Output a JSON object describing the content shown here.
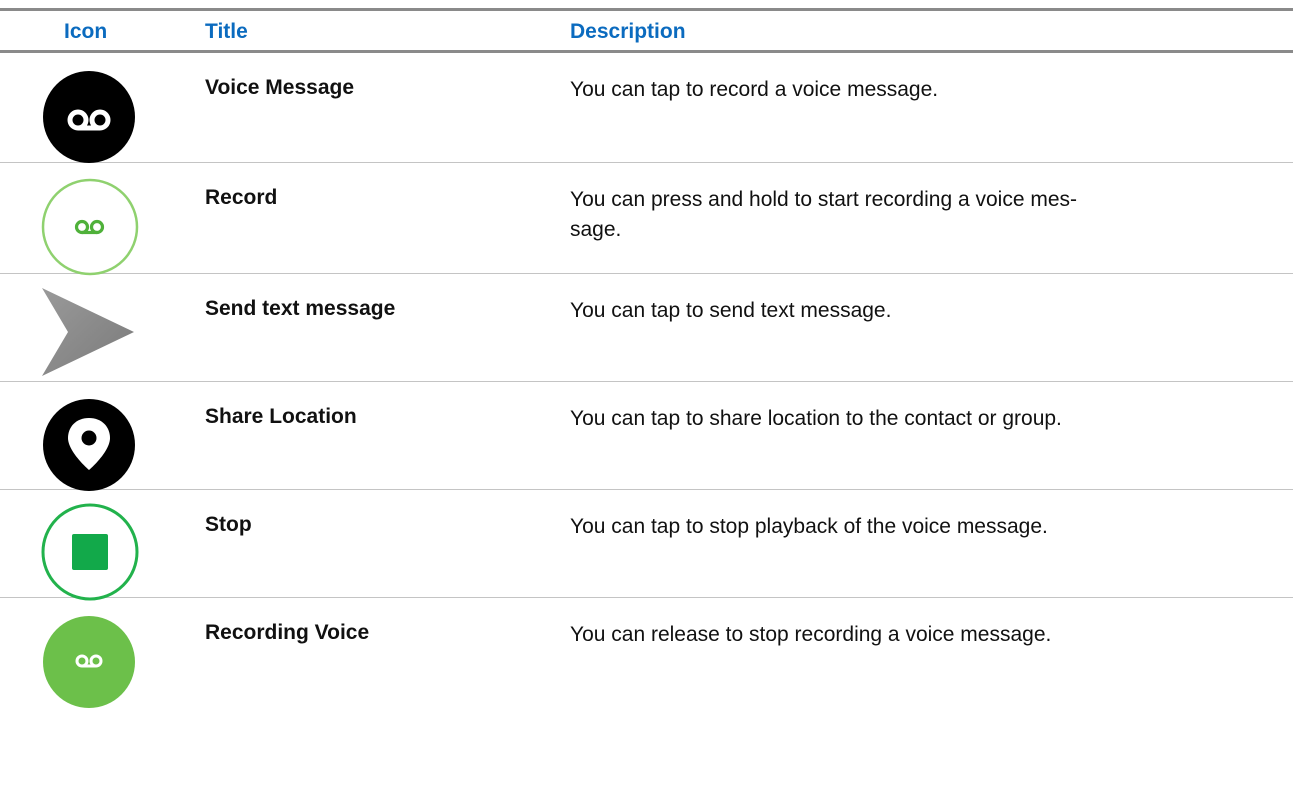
{
  "table": {
    "headers": {
      "icon": "Icon",
      "title": "Title",
      "description": "Description"
    },
    "rows": [
      {
        "icon": "voicemail-black-circle-icon",
        "title": "Voice Message",
        "description": "You can tap to record a voice message."
      },
      {
        "icon": "voicemail-green-outline-circle-icon",
        "title": "Record",
        "description": "You can press and hold to start recording a voice mes-\nsage."
      },
      {
        "icon": "send-arrow-icon",
        "title": "Send text message",
        "description": "You can tap to send text message."
      },
      {
        "icon": "location-pin-black-circle-icon",
        "title": "Share Location",
        "description": "You can tap to share location to the contact or group."
      },
      {
        "icon": "stop-green-square-circle-icon",
        "title": "Stop",
        "description": "You can tap to stop playback of the voice message."
      },
      {
        "icon": "voicemail-green-filled-circle-icon",
        "title": "Recording Voice",
        "description": "You can release to stop recording a voice message."
      }
    ]
  },
  "colors": {
    "header_text": "#0b6bbf",
    "rule_dark": "#8a8a8a",
    "rule_light": "#c4c4c4",
    "icon_black": "#000000",
    "icon_green": "#6cc04a",
    "icon_green_dark": "#12a94a",
    "icon_gray": "#8c8c8c"
  }
}
